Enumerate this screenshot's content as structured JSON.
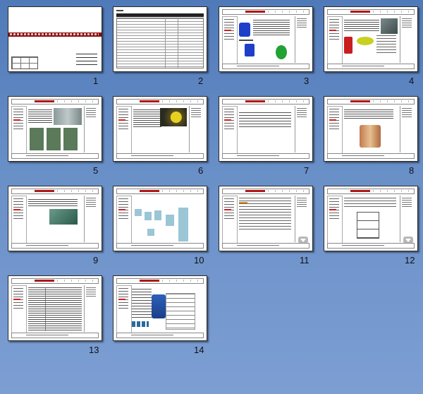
{
  "window": {
    "view": "slide-sorter"
  },
  "colors": {
    "background_top": "#4f79b8",
    "background_bottom": "#7c9ed3",
    "accent_red": "#b01818"
  },
  "slides": [
    {
      "number": "1"
    },
    {
      "number": "2"
    },
    {
      "number": "3"
    },
    {
      "number": "4"
    },
    {
      "number": "5"
    },
    {
      "number": "6"
    },
    {
      "number": "7"
    },
    {
      "number": "8"
    },
    {
      "number": "9"
    },
    {
      "number": "10"
    },
    {
      "number": "11"
    },
    {
      "number": "12"
    },
    {
      "number": "13"
    },
    {
      "number": "14"
    }
  ]
}
